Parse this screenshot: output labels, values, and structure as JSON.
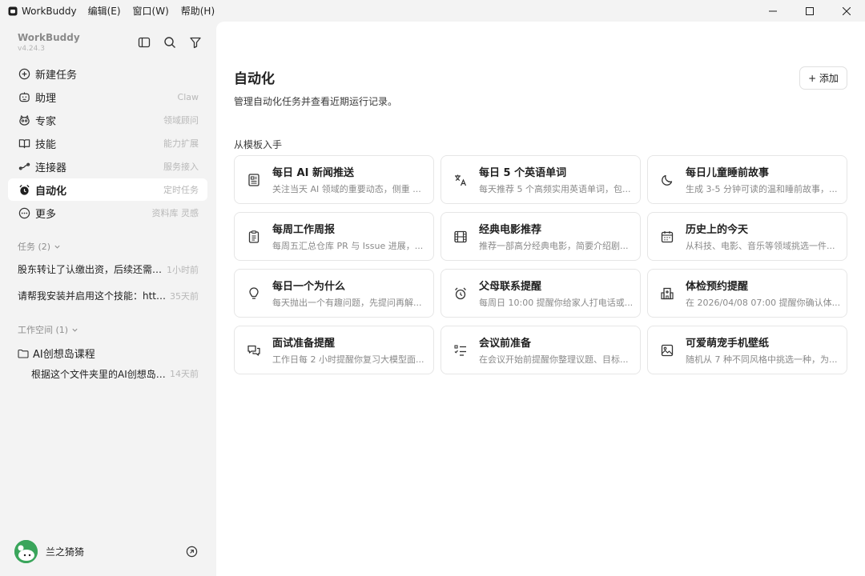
{
  "titlebar": {
    "app_name": "WorkBuddy",
    "menus": [
      "编辑(E)",
      "窗口(W)",
      "帮助(H)"
    ]
  },
  "sidebar": {
    "brand": "WorkBuddy",
    "version": "v4.24.3",
    "nav": [
      {
        "label": "新建任务",
        "hint": "",
        "icon": "plus-circle-icon"
      },
      {
        "label": "助理",
        "hint": "Claw",
        "icon": "assistant-icon"
      },
      {
        "label": "专家",
        "hint": "领域顾问",
        "icon": "expert-icon"
      },
      {
        "label": "技能",
        "hint": "能力扩展",
        "icon": "book-icon"
      },
      {
        "label": "连接器",
        "hint": "服务接入",
        "icon": "connector-icon"
      },
      {
        "label": "自动化",
        "hint": "定时任务",
        "icon": "alarm-icon",
        "active": true
      },
      {
        "label": "更多",
        "hint": "资料库 灵感",
        "icon": "more-icon"
      }
    ],
    "tasks_header": "任务 (2)",
    "tasks": [
      {
        "text": "股东转让了认缴出资，后续还需要...",
        "time": "1小时前"
      },
      {
        "text": "请帮我安装并启用这个技能：https:...",
        "time": "35天前"
      }
    ],
    "workspace_header": "工作空间 (1)",
    "workspace_folder": "AI创想岛课程",
    "workspace_file": {
      "text": "根据这个文件夹里的AI创想岛课...",
      "time": "14天前"
    },
    "user_name": "兰之猗猗"
  },
  "main": {
    "title": "自动化",
    "description": "管理自动化任务并查看近期运行记录。",
    "add_label": "+ 添加",
    "section_label": "从模板入手",
    "cards": [
      {
        "title": "每日 AI 新闻推送",
        "desc": "关注当天 AI 领域的重要动态，侧重 ...",
        "icon": "news-icon"
      },
      {
        "title": "每日 5 个英语单词",
        "desc": "每天推荐 5 个高频实用英语单词，包...",
        "icon": "translate-icon"
      },
      {
        "title": "每日儿童睡前故事",
        "desc": "生成 3-5 分钟可读的温和睡前故事，...",
        "icon": "moon-icon"
      },
      {
        "title": "每周工作周报",
        "desc": "每周五汇总仓库 PR 与 Issue 进展，...",
        "icon": "clipboard-icon"
      },
      {
        "title": "经典电影推荐",
        "desc": "推荐一部高分经典电影，简要介绍剧...",
        "icon": "film-icon"
      },
      {
        "title": "历史上的今天",
        "desc": "从科技、电影、音乐等领域挑选一件...",
        "icon": "calendar-icon"
      },
      {
        "title": "每日一个为什么",
        "desc": "每天抛出一个有趣问题，先提问再解...",
        "icon": "lightbulb-icon"
      },
      {
        "title": "父母联系提醒",
        "desc": "每周日 10:00 提醒你给家人打电话或...",
        "icon": "alarm-clock-icon"
      },
      {
        "title": "体检预约提醒",
        "desc": "在 2026/04/08 07:00 提醒你确认体...",
        "icon": "hospital-icon"
      },
      {
        "title": "面试准备提醒",
        "desc": "工作日每 2 小时提醒你复习大模型面...",
        "icon": "chat-icon"
      },
      {
        "title": "会议前准备",
        "desc": "在会议开始前提醒你整理议题、目标...",
        "icon": "checklist-icon"
      },
      {
        "title": "可爱萌宠手机壁纸",
        "desc": "随机从 7 种不同风格中挑选一种，为...",
        "icon": "image-icon"
      }
    ]
  }
}
